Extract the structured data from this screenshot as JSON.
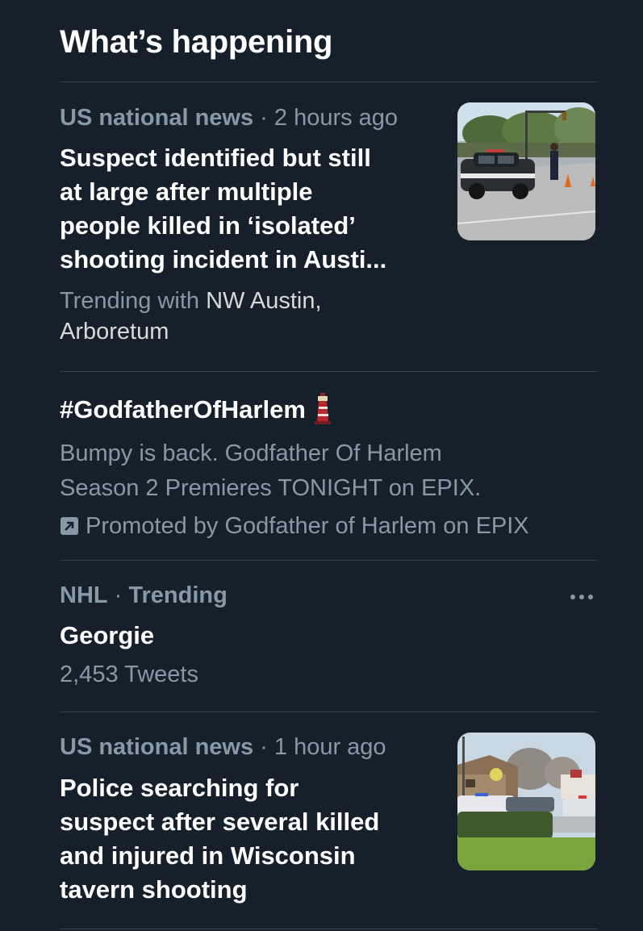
{
  "header": {
    "title": "What’s happening"
  },
  "trends": [
    {
      "category": "US national news",
      "separator": " · ",
      "time": "2 hours ago",
      "headline": "Suspect identified but still\nat large after multiple\npeople killed in ‘isolated’\nshooting incident in Austi...",
      "trending_prefix": "Trending with ",
      "trending_with": "NW Austin,\nArboretum",
      "thumbnail": "police-car-street-photo"
    },
    {
      "hashtag": "#GodfatherOfHarlem",
      "emoji": "lighthouse-icon",
      "description": "Bumpy is back. Godfather Of Harlem\nSeason 2 Premieres TONIGHT on EPIX.",
      "promoted_label": "Promoted by Godfather of Harlem on EPIX"
    },
    {
      "category": "NHL",
      "separator": " · ",
      "status": "Trending",
      "name": "Georgie",
      "tweet_count": "2,453 Tweets",
      "more_icon": "more-dots-icon"
    },
    {
      "category": "US national news",
      "separator": " · ",
      "time": "1 hour ago",
      "headline": "Police searching for\nsuspect after several killed\nand injured in Wisconsin\ntavern shooting",
      "thumbnail": "tavern-police-scene-photo"
    }
  ],
  "colors": {
    "background": "#15202b",
    "divider": "#38444d",
    "secondary_text": "#8899a6",
    "primary_text": "#ffffff"
  }
}
